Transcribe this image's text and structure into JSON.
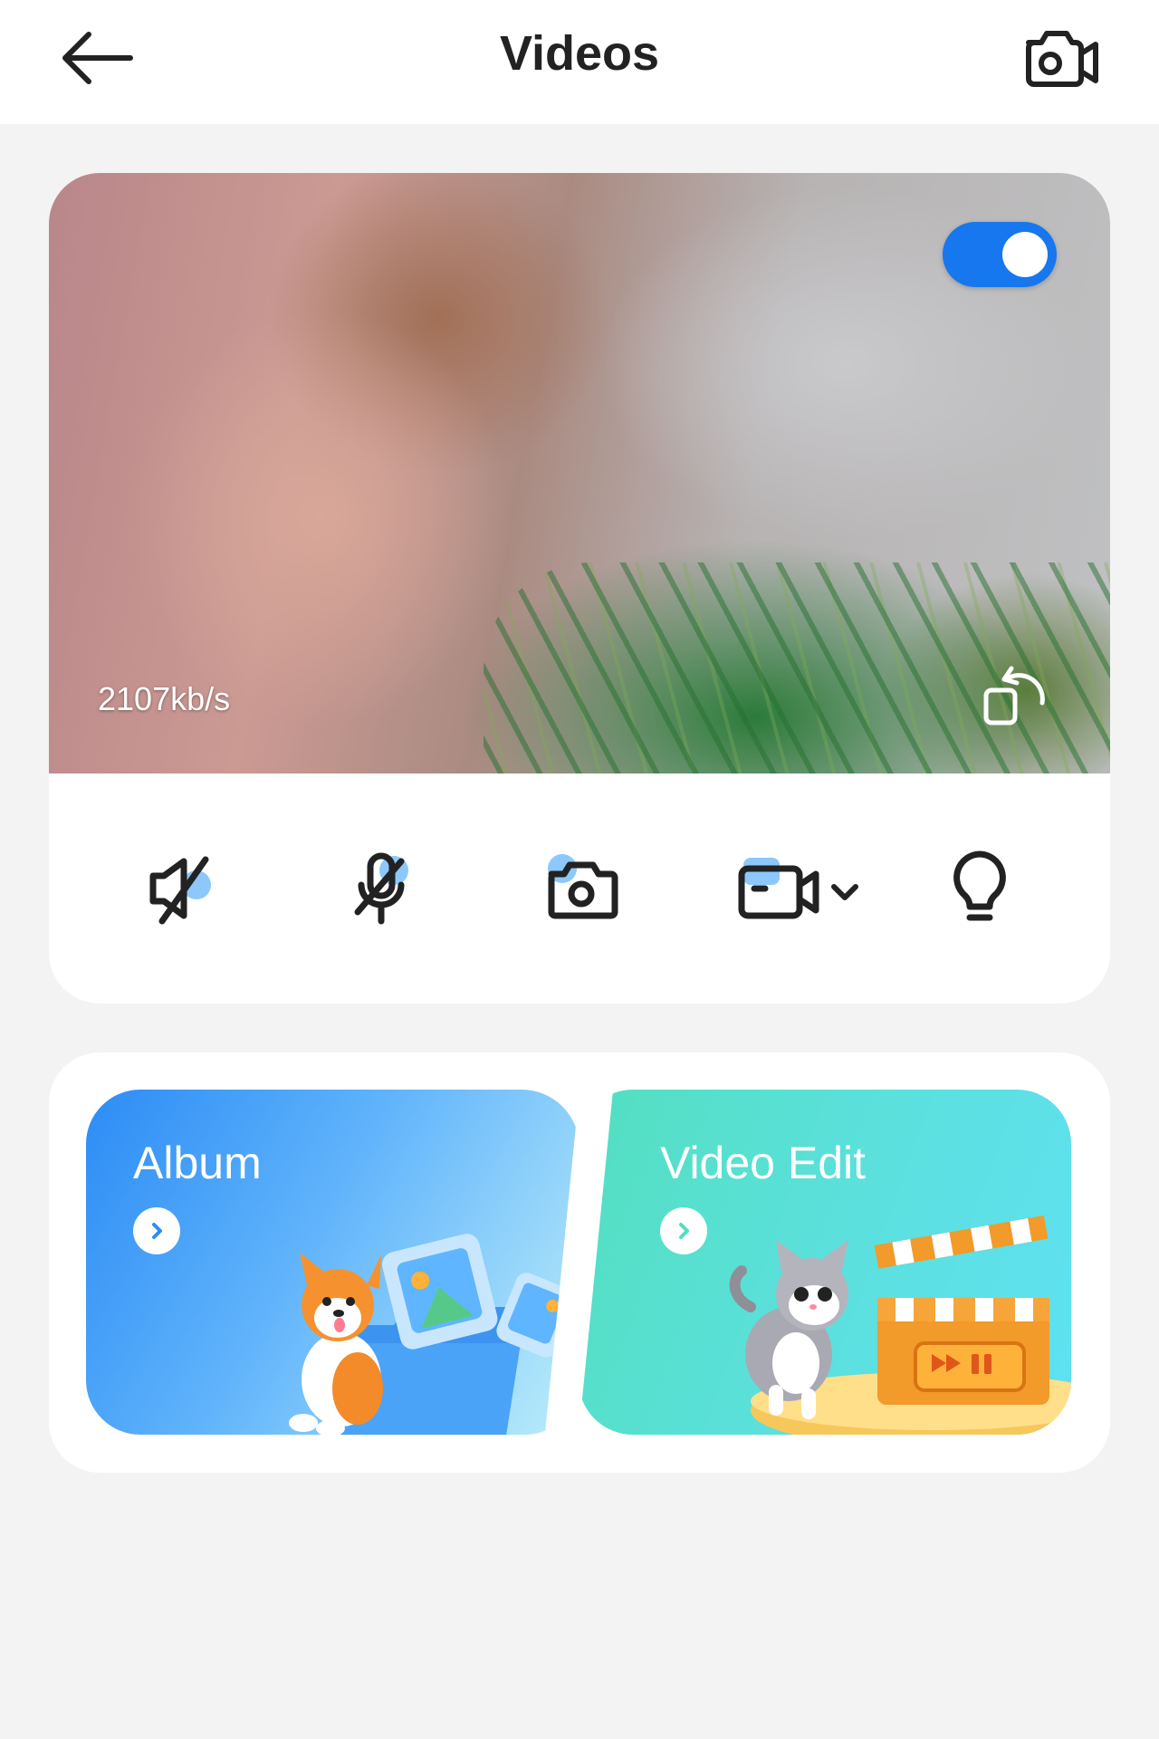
{
  "header": {
    "title": "Videos",
    "back_icon": "back-arrow-icon",
    "right_icon": "switch-camera-icon"
  },
  "video": {
    "bitrate": "2107kb/s",
    "live_toggle_on": true,
    "toggle_color": "#1a76e8"
  },
  "controls": [
    {
      "name": "mute-speaker",
      "icon": "speaker-off-icon"
    },
    {
      "name": "mute-mic",
      "icon": "mic-off-icon"
    },
    {
      "name": "snapshot",
      "icon": "camera-icon"
    },
    {
      "name": "record",
      "icon": "video-record-icon"
    },
    {
      "name": "light",
      "icon": "lightbulb-icon"
    }
  ],
  "features": {
    "album": {
      "label": "Album",
      "color": "#2c8cf5"
    },
    "video_edit": {
      "label": "Video Edit",
      "color": "#52dfc0"
    }
  }
}
